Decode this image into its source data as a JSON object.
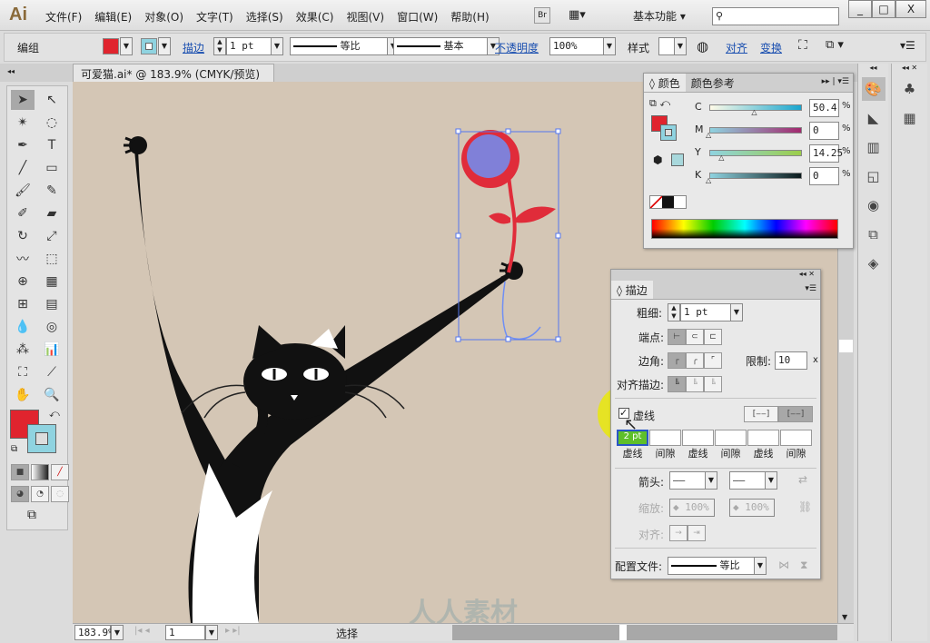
{
  "app": {
    "logo": "Ai",
    "menu": [
      "文件(F)",
      "编辑(E)",
      "对象(O)",
      "文字(T)",
      "选择(S)",
      "效果(C)",
      "视图(V)",
      "窗口(W)",
      "帮助(H)"
    ],
    "bridge": "Br",
    "workspace": "基本功能",
    "search_placeholder": "",
    "win": [
      "_",
      "□",
      "X"
    ]
  },
  "control": {
    "selection": "编组",
    "fill_color": "#e0242e",
    "stroke_color": "#8fd3e0",
    "stroke_label": "描边",
    "stroke_weight": "1 pt",
    "profile1": "等比",
    "profile2": "基本",
    "opacity_label": "不透明度",
    "opacity": "100%",
    "style_label": "样式",
    "align": "对齐",
    "transform": "变换"
  },
  "document": {
    "tab": "可爱猫.ai* @ 183.9% (CMYK/预览)",
    "close": "x"
  },
  "color_panel": {
    "tabs": [
      "颜色",
      "颜色参考"
    ],
    "channels": [
      {
        "label": "C",
        "value": "50.4",
        "pct": 50.4,
        "grad": "linear-gradient(90deg,#fffbe8,#19a6cf)"
      },
      {
        "label": "M",
        "value": "0",
        "pct": 0,
        "grad": "linear-gradient(90deg,#8fd3e0,#a3286e)"
      },
      {
        "label": "Y",
        "value": "14.25",
        "pct": 14.25,
        "grad": "linear-gradient(90deg,#8fd3e0,#9cce4a)"
      },
      {
        "label": "K",
        "value": "0",
        "pct": 0,
        "grad": "linear-gradient(90deg,#8fd3e0,#0b1a1c)"
      }
    ],
    "unit": "%"
  },
  "stroke_panel": {
    "tab": "描边",
    "weight_label": "粗细:",
    "weight": "1 pt",
    "cap_label": "端点:",
    "corner_label": "边角:",
    "limit_label": "限制:",
    "limit": "10",
    "limit_unit": "x",
    "align_label": "对齐描边:",
    "dashed_label": "虚线",
    "dashed_checked": true,
    "dash_values": [
      "2 pt",
      "",
      "",
      "",
      "",
      ""
    ],
    "dash_labels": [
      "虚线",
      "间隙",
      "虚线",
      "间隙",
      "虚线",
      "间隙"
    ],
    "arrow_label": "箭头:",
    "scale_label": "缩放:",
    "scale1": "100%",
    "scale2": "100%",
    "arrow_align_label": "对齐:",
    "profile_label": "配置文件:",
    "profile": "等比"
  },
  "status": {
    "zoom": "183.9%",
    "page": "1",
    "tool": "选择"
  },
  "watermark": "人人素材"
}
